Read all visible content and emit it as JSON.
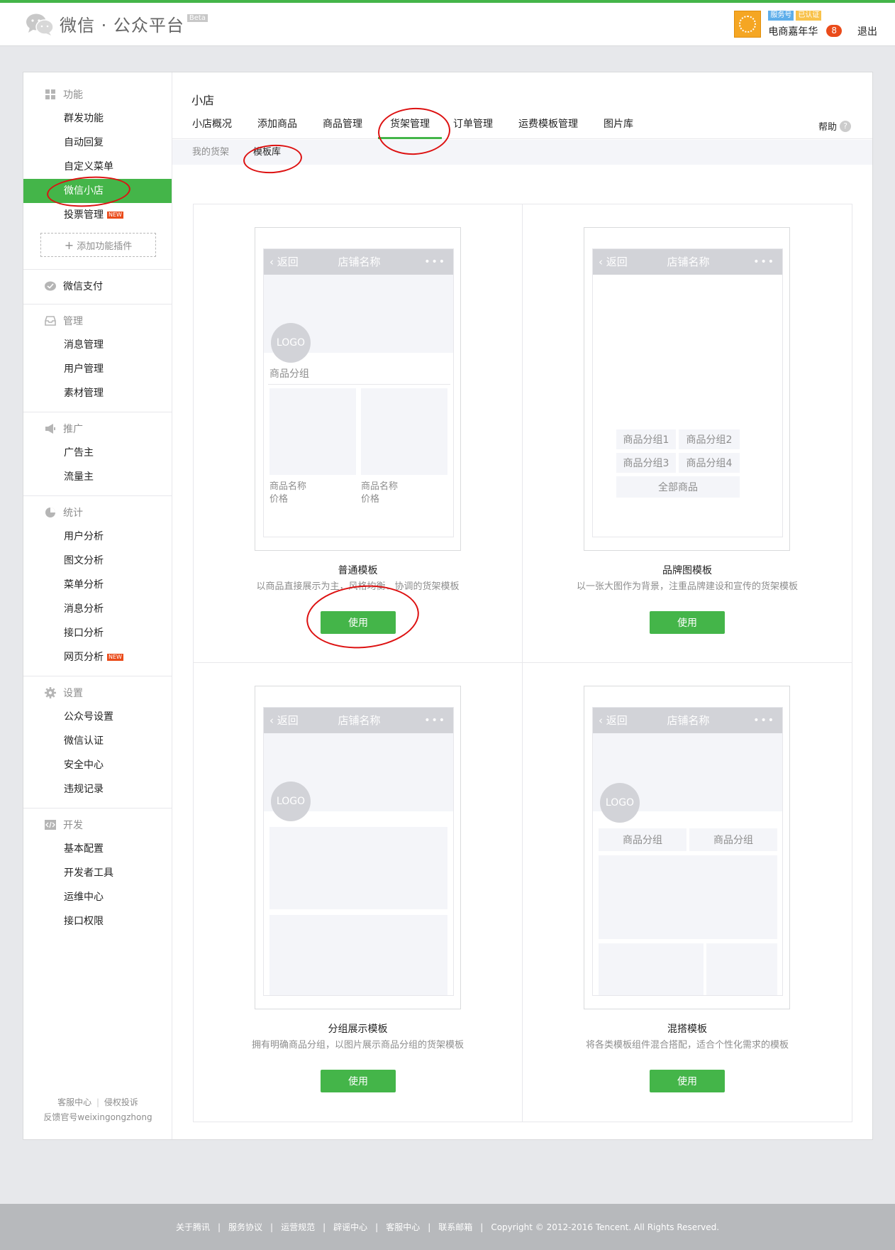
{
  "header": {
    "platform_title": "微信 · 公众平台",
    "beta_label": "Beta",
    "account_type_badge": "服务号",
    "verified_badge": "已认证",
    "account_name": "电商嘉年华",
    "message_count": "8",
    "logout_label": "退出"
  },
  "sidebar": {
    "groups": [
      {
        "title": "功能",
        "icon": "grid-icon",
        "items": [
          {
            "label": "群发功能"
          },
          {
            "label": "自动回复"
          },
          {
            "label": "自定义菜单"
          },
          {
            "label": "微信小店",
            "active": true
          },
          {
            "label": "投票管理",
            "new": true
          }
        ],
        "add_plugin_label": "添加功能插件"
      },
      {
        "title": "微信支付",
        "icon": "pay-icon",
        "items": []
      },
      {
        "title": "管理",
        "icon": "inbox-icon",
        "items": [
          {
            "label": "消息管理"
          },
          {
            "label": "用户管理"
          },
          {
            "label": "素材管理"
          }
        ]
      },
      {
        "title": "推广",
        "icon": "megaphone-icon",
        "items": [
          {
            "label": "广告主"
          },
          {
            "label": "流量主"
          }
        ]
      },
      {
        "title": "统计",
        "icon": "pie-chart-icon",
        "items": [
          {
            "label": "用户分析"
          },
          {
            "label": "图文分析"
          },
          {
            "label": "菜单分析"
          },
          {
            "label": "消息分析"
          },
          {
            "label": "接口分析"
          },
          {
            "label": "网页分析",
            "new": true
          }
        ]
      },
      {
        "title": "设置",
        "icon": "gear-icon",
        "items": [
          {
            "label": "公众号设置"
          },
          {
            "label": "微信认证"
          },
          {
            "label": "安全中心"
          },
          {
            "label": "违规记录"
          }
        ]
      },
      {
        "title": "开发",
        "icon": "code-icon",
        "items": [
          {
            "label": "基本配置"
          },
          {
            "label": "开发者工具"
          },
          {
            "label": "运维中心"
          },
          {
            "label": "接口权限"
          }
        ]
      }
    ],
    "new_tag": "NEW",
    "footer_link_service": "客服中心",
    "footer_link_complaint": "侵权投诉",
    "footer_feedback": "反馈官号weixingongzhong"
  },
  "main": {
    "page_title": "小店",
    "tabs": [
      {
        "label": "小店概况"
      },
      {
        "label": "添加商品"
      },
      {
        "label": "商品管理"
      },
      {
        "label": "货架管理",
        "active": true
      },
      {
        "label": "订单管理"
      },
      {
        "label": "运费模板管理"
      },
      {
        "label": "图片库"
      }
    ],
    "help_label": "帮助",
    "subtabs": [
      {
        "label": "我的货架"
      },
      {
        "label": "模板库",
        "active": true
      }
    ]
  },
  "preview": {
    "back_label": "返回",
    "shop_name": "店铺名称",
    "logo_label": "LOGO",
    "group_label": "商品分组",
    "product_name": "商品名称",
    "price_label": "价格",
    "group1": "商品分组1",
    "group2": "商品分组2",
    "group3": "商品分组3",
    "group4": "商品分组4",
    "all_products": "全部商品"
  },
  "templates": [
    {
      "name": "普通模板",
      "description": "以商品直接展示为主，风格均衡、协调的货架模板",
      "button": "使用"
    },
    {
      "name": "品牌图模板",
      "description": "以一张大图作为背景，注重品牌建设和宣传的货架模板",
      "button": "使用"
    },
    {
      "name": "分组展示模板",
      "description": "拥有明确商品分组，以图片展示商品分组的货架模板",
      "button": "使用"
    },
    {
      "name": "混搭模板",
      "description": "将各类模板组件混合搭配，适合个性化需求的模板",
      "button": "使用"
    }
  ],
  "footer": {
    "links": [
      "关于腾讯",
      "服务协议",
      "运营规范",
      "辟谣中心",
      "客服中心",
      "联系邮箱"
    ],
    "copyright": "Copyright © 2012-2016 Tencent. All Rights Reserved."
  },
  "colors": {
    "brand_green": "#44b549",
    "annotation_red": "#dd1111",
    "badge_blue": "#5eaeea",
    "badge_yellow": "#f8c24b",
    "count_red": "#ea4b1a"
  }
}
